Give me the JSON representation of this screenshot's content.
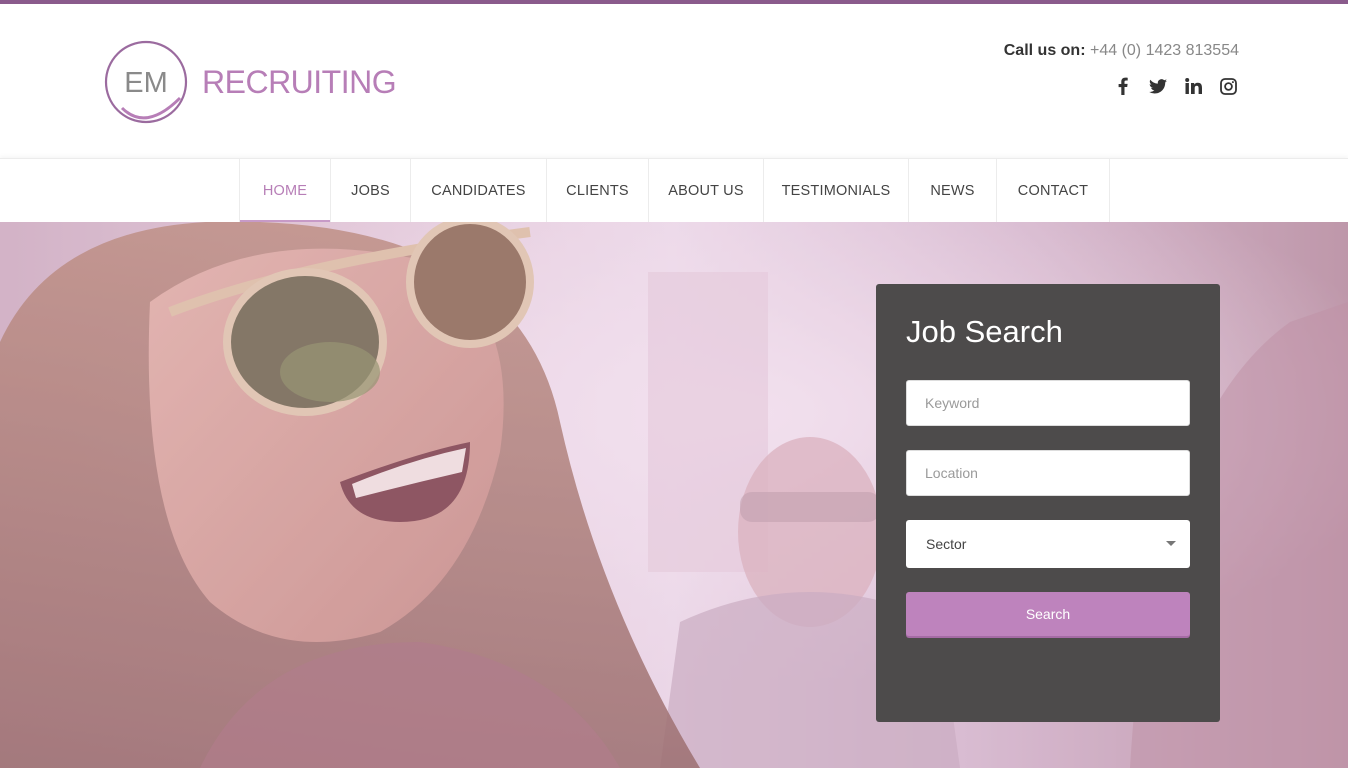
{
  "brand": {
    "logo_initials": "EM",
    "logo_word": "RECRUITING",
    "accent_color": "#b77eb7"
  },
  "contact": {
    "call_label": "Call us on:",
    "phone": "+44 (0) 1423 813554"
  },
  "social": [
    "facebook-icon",
    "twitter-icon",
    "linkedin-icon",
    "instagram-icon"
  ],
  "nav": {
    "items": [
      {
        "label": "HOME",
        "active": true
      },
      {
        "label": "JOBS"
      },
      {
        "label": "CANDIDATES"
      },
      {
        "label": "CLIENTS"
      },
      {
        "label": "ABOUT US"
      },
      {
        "label": "TESTIMONIALS"
      },
      {
        "label": "NEWS"
      },
      {
        "label": "CONTACT"
      }
    ]
  },
  "job_search": {
    "title": "Job Search",
    "keyword_placeholder": "Keyword",
    "location_placeholder": "Location",
    "sector_selected": "Sector",
    "search_label": "Search"
  }
}
